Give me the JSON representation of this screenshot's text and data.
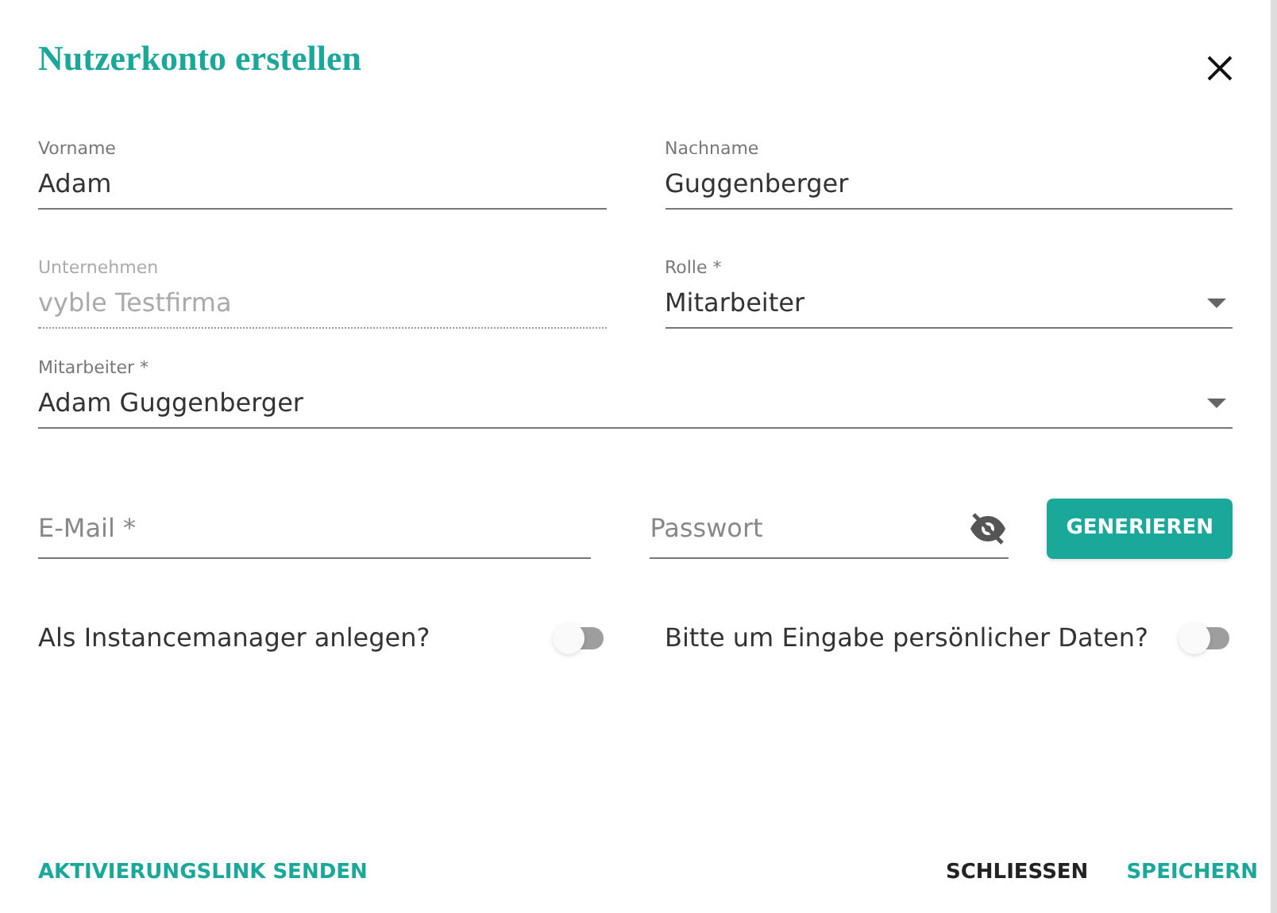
{
  "dialog": {
    "title": "Nutzerkonto erstellen"
  },
  "rows": [
    [
      {
        "kind": "text",
        "label": "Vorname",
        "value": "Adam",
        "disabled": false
      },
      {
        "kind": "text",
        "label": "Nachname",
        "value": "Guggenberger",
        "disabled": false
      }
    ],
    [
      {
        "kind": "text",
        "label": "Unternehmen",
        "value": "vyble Testfirma",
        "disabled": true
      },
      {
        "kind": "select",
        "label": "Rolle *",
        "value": "Mitarbeiter",
        "disabled": false
      }
    ],
    [
      {
        "kind": "select",
        "label": "Mitarbeiter *",
        "value": "Adam Guggenberger",
        "disabled": false
      }
    ]
  ],
  "email": {
    "placeholder": "E-Mail *"
  },
  "password": {
    "placeholder": "Passwort",
    "visible": false
  },
  "generate_button": "GENERIEREN",
  "toggles": [
    {
      "label": "Als Instancemanager anlegen?",
      "on": false
    },
    {
      "label": "Bitte um Eingabe persönlicher Daten?",
      "on": false
    }
  ],
  "footer": {
    "left": "AKTIVIERUNGSLINK SENDEN",
    "buttons": [
      {
        "label": "SCHLIESSEN",
        "primary": false
      },
      {
        "label": "SPEICHERN",
        "primary": true
      }
    ]
  }
}
